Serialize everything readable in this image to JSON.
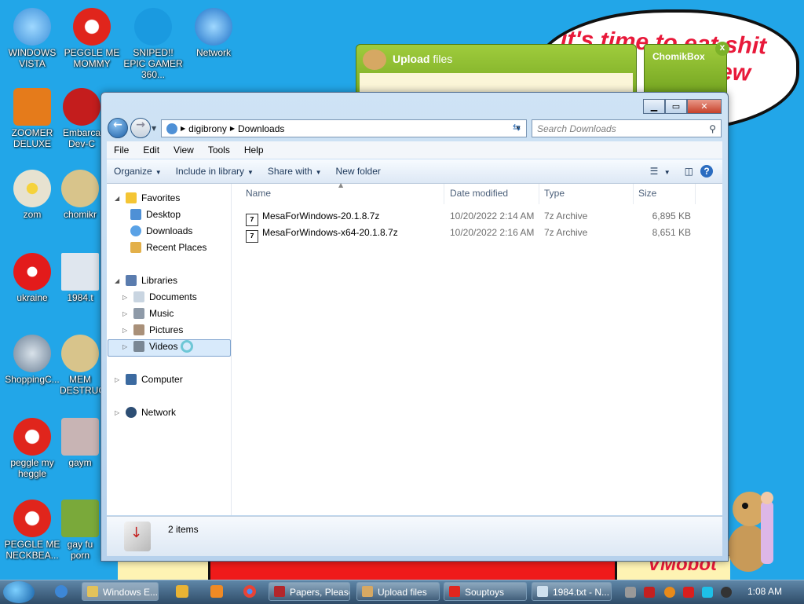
{
  "wallpaper": {
    "bubble_line1": "it's time to eat shit",
    "bubble_line2": "ew",
    "signature": "VMobot"
  },
  "desktop_icons": [
    {
      "label": "WINDOWS VISTA",
      "color": "#3b8fd9"
    },
    {
      "label": "PEGGLE ME MOMMY",
      "color": "#e0251c"
    },
    {
      "label": "SNIPED!! EPIC GAMER 360...",
      "color": "#1a9ae0"
    },
    {
      "label": "Network",
      "color": "#1b6fc7"
    },
    {
      "label": "ZOOMER DELUXE",
      "color": "#e57b1b"
    },
    {
      "label": "Embarca Dev-C",
      "color": "#c41d1d"
    },
    {
      "label": "zom",
      "color": "#e7e2d0"
    },
    {
      "label": "chomikr",
      "color": "#d8c48b"
    },
    {
      "label": "ukraine",
      "color": "#e31b1b"
    },
    {
      "label": "1984.t",
      "color": "#dfe6ee"
    },
    {
      "label": "ShoppingC...",
      "color": "#6a7f95"
    },
    {
      "label": "MEM DESTRUC",
      "color": "#d8c48b"
    },
    {
      "label": "peggle my heggle",
      "color": "#e0251c"
    },
    {
      "label": "gaym",
      "color": "#c8b4b4"
    },
    {
      "label": "PEGGLE ME NECKBEA...",
      "color": "#e0251c"
    },
    {
      "label": "gay fu porn",
      "color": "#7aa93a"
    }
  ],
  "upload_widget": {
    "title_bold": "Upload",
    "title_rest": " files"
  },
  "chomikbox": {
    "title": "ChomikBox",
    "close": "x"
  },
  "explorer": {
    "caption_buttons": {
      "minimize": "▁",
      "maximize": "▭",
      "close": "✕"
    },
    "address": {
      "root_icon": "computer-icon",
      "crumbs": [
        "digibrony",
        "Downloads"
      ]
    },
    "search_placeholder": "Search Downloads",
    "menu": [
      "File",
      "Edit",
      "View",
      "Tools",
      "Help"
    ],
    "commands": [
      "Organize",
      "Include in library",
      "Share with",
      "New folder"
    ],
    "nav": {
      "favorites": {
        "label": "Favorites",
        "items": [
          "Desktop",
          "Downloads",
          "Recent Places"
        ]
      },
      "libraries": {
        "label": "Libraries",
        "items": [
          "Documents",
          "Music",
          "Pictures",
          "Videos"
        ]
      },
      "computer": "Computer",
      "network": "Network"
    },
    "columns": [
      "Name",
      "Date modified",
      "Type",
      "Size"
    ],
    "files": [
      {
        "name": "MesaForWindows-20.1.8.7z",
        "date": "10/20/2022 2:14 AM",
        "type": "7z Archive",
        "size": "6,895 KB"
      },
      {
        "name": "MesaForWindows-x64-20.1.8.7z",
        "date": "10/20/2022 2:16 AM",
        "type": "7z Archive",
        "size": "8,651 KB"
      }
    ],
    "status": "2 items"
  },
  "taskbar": {
    "buttons": [
      "Windows E...",
      "Papers, Please",
      "Upload files",
      "Souptoys",
      "1984.txt - N..."
    ],
    "clock": "1:08 AM"
  },
  "colors": {
    "desktop": "#22a6e8",
    "taskbar": "#2f4c68",
    "selection": "#d8eafb"
  }
}
